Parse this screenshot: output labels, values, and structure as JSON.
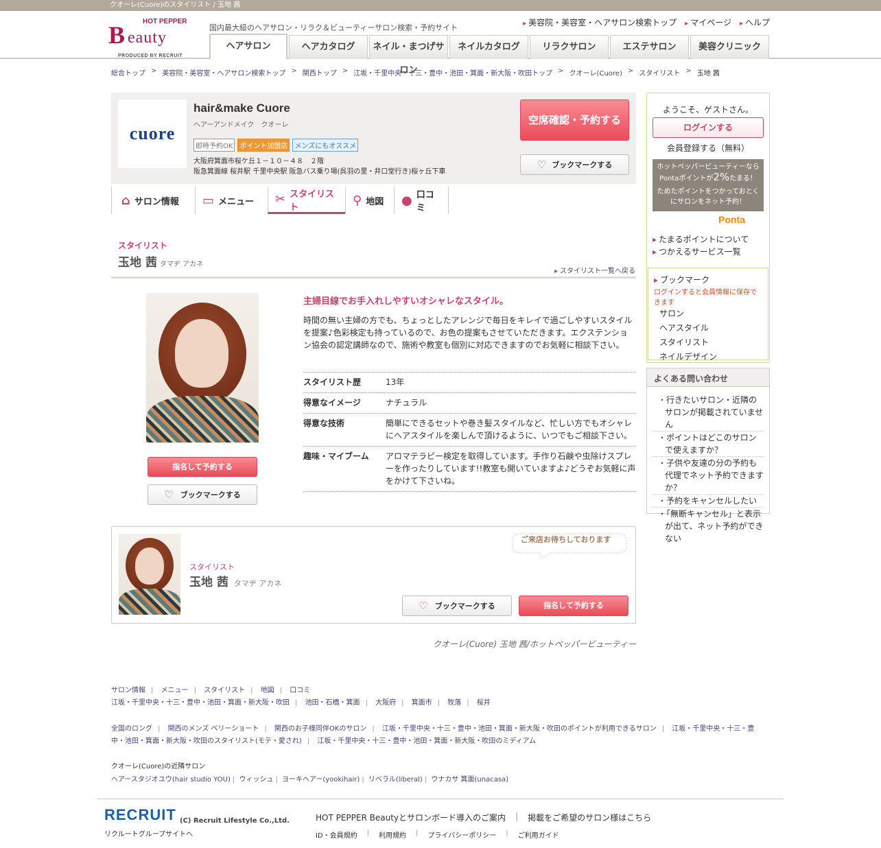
{
  "topbar": "クオーレ(Cuore)のスタイリスト / 玉地 茜",
  "brand": {
    "hot_pepper": "HOT PEPPER",
    "b": "B",
    "eauty": "eauty",
    "produced": "PRODUCED BY RECRUIT"
  },
  "tagline": "国内最大級のヘアサロン・リラク＆ビューティーサロン検索・予約サイト",
  "top_links": [
    "美容院・美容室・ヘアサロン検索トップ",
    "マイページ",
    "ヘルプ"
  ],
  "global_tabs": [
    "ヘアサロン",
    "ヘアカタログ",
    "ネイル・まつげサロン",
    "ネイルカタログ",
    "リラクサロン",
    "エステサロン",
    "美容クリニック"
  ],
  "breadcrumb": [
    "総合トップ",
    "美容院・美容室・ヘアサロン検索トップ",
    "関西トップ",
    "江坂・千里中央・十三・豊中・池田・箕面・新大阪・吹田トップ",
    "クオーレ(Cuore)",
    "スタイリスト",
    "玉地 茜"
  ],
  "salon": {
    "logo_text": "cuore",
    "name": "hair&make Cuore",
    "kana": "ヘアーアンドメイク　クオーレ",
    "badges": [
      "即時予約OK",
      "ポイント加盟店",
      "メンズにもオススメ"
    ],
    "address": "大阪府箕面市桜ケ丘１－１０－４８　２階",
    "access": "阪急箕面線 桜井駅  千里中央駅 阪急バス乗り場(呉羽の里・井口堂行き)桜ヶ丘下車",
    "reserve_label": "空席確認・予約する",
    "bookmark_label": "ブックマークする"
  },
  "salon_tabs": [
    {
      "label": "サロン情報",
      "icon": "home-icon"
    },
    {
      "label": "メニュー",
      "icon": "menu-book-icon"
    },
    {
      "label": "スタイリスト",
      "icon": "scissors-icon"
    },
    {
      "label": "地図",
      "icon": "map-pin-icon"
    },
    {
      "label": "口コミ",
      "icon": "speech-bubble-icon"
    }
  ],
  "stylist": {
    "section_label": "スタイリスト",
    "name": "玉地 茜",
    "kana": "タマヂ アカネ",
    "back_link": "スタイリスト一覧へ戻る",
    "catch": "主婦目線でお手入れしやすいオシャレなスタイル。",
    "description": "時間の無い主婦の方でも、ちょっとしたアレンジで毎日をキレイで過ごしやすいスタイルを提案♪色彩検定も持っているので、お色の提案もさせていただきます。エクステンション協会の認定講師なので、施術や教室も個別に対応できますのでお気軽に相談下さい。",
    "reserve_label": "指名して予約する",
    "bookmark_label": "ブックマークする",
    "details": [
      {
        "key": "スタイリスト歴",
        "value": "13年"
      },
      {
        "key": "得意なイメージ",
        "value": "ナチュラル"
      },
      {
        "key": "得意な技術",
        "value": "簡単にできるセットや巻き髪スタイルなど、忙しい方でもオシャレにヘアスタイルを楽しんで頂けるように、いつでもご相談下さい。"
      },
      {
        "key": "趣味・マイブーム",
        "value": "アロマテラピー検定を取得しています。手作り石鹸や虫除けスプレーを作ったりしています!!教室も開いていますよ♪どうぞお気軽に声をかけて下さいね。"
      }
    ],
    "card_bubble": "ご来店お待ちしております",
    "caption": "クオーレ(Cuore) 玉地 茜/ホットペッパービューティー"
  },
  "sidebar": {
    "welcome": "ようこそ、ゲストさん。",
    "login": "ログインする",
    "register": "会員登録する（無料）",
    "ponta_line1": "ホットペッパービューティーなら",
    "ponta_line2a": "Pontaポイントが",
    "ponta_pct": "2%",
    "ponta_line2b": "たまる！",
    "ponta_line3": "ためたポイントをつかっておとくにサロンをネット予約！",
    "ponta_logo": "Ponta",
    "links": [
      "たまるポイントについて",
      "つかえるサービス一覧"
    ],
    "bookmark_title": "ブックマーク",
    "bookmark_note": "ログインすると会員情報に保存できます",
    "bookmark_items": [
      "サロン",
      "ヘアスタイル",
      "スタイリスト",
      "ネイルデザイン"
    ],
    "faq_title": "よくある問い合わせ",
    "faq": [
      "行きたいサロン・近隣のサロンが掲載されていません",
      "ポイントはどこのサロンで使えますか？",
      "子供や友達の分の予約も代理でネット予約できますか？",
      "予約をキャンセルしたい",
      "「無断キャンセル」と表示が出て、ネット予約ができない"
    ]
  },
  "footer_links": {
    "row1": [
      "サロン情報",
      "メニュー",
      "スタイリスト",
      "地図",
      "口コミ"
    ],
    "row2": [
      "江坂・千里中央・十三・豊中・池田・箕面・新大阪・吹田",
      "池田・石橋・箕面",
      "大阪府",
      "箕面市",
      "牧落",
      "桜井"
    ],
    "row3": [
      "全国のロング",
      "関西のメンズ ベリーショート",
      "関西のお子様同伴OKのサロン",
      "江坂・千里中央・十三・豊中・池田・箕面・新大阪・吹田のポイントが利用できるサロン",
      "江坂・千里中央・十三・豊中・池田・箕面・新大阪・吹田のスタイリスト(モテ・愛され)",
      "江坂・千里中央・十三・豊中・池田・箕面・新大阪・吹田のミディアム"
    ],
    "nearby_title": "クオーレ(Cuore)の近隣サロン",
    "nearby": [
      "ヘアースタジオユウ(hair studio YOU)",
      "ウィッシュ",
      "ヨーキヘアー(yookihair)",
      "リベラル(liberal)",
      "ウナカサ 箕面(unacasa)"
    ]
  },
  "footer": {
    "recruit": "RECRUIT",
    "copyright": "(C) Recruit Lifestyle Co.,Ltd.",
    "group": "リクルートグループサイトへ",
    "info": [
      "HOT PEPPER Beautyとサロンボード導入のご案内",
      "掲載をご希望のサロン様はこちら"
    ],
    "sub": [
      "ID・会員規約",
      "利用規約",
      "プライバシーポリシー",
      "ご利用ガイド"
    ]
  }
}
